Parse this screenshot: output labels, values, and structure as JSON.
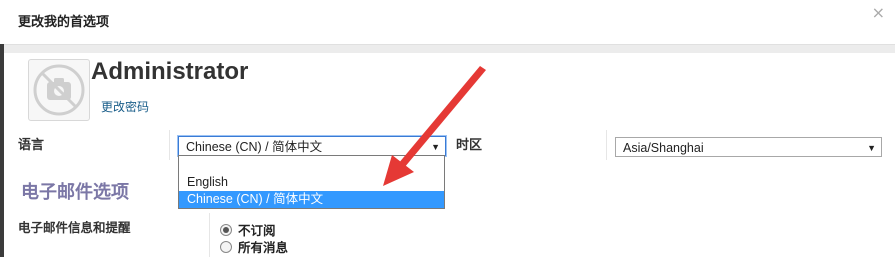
{
  "dialog": {
    "title": "更改我的首选项",
    "close_label": "×"
  },
  "profile": {
    "avatar_icon": "camera-off-icon",
    "name": "Administrator",
    "change_password_link": "更改密码"
  },
  "language": {
    "label": "语言",
    "selected": "Chinese (CN) / 简体中文",
    "options": [
      "English",
      "Chinese (CN) / 简体中文"
    ],
    "dropdown_open": true
  },
  "timezone": {
    "label": "时区",
    "selected": "Asia/Shanghai"
  },
  "email_options": {
    "section_title": "电子邮件选项",
    "notifications_label": "电子邮件信息和提醒",
    "radio_options": [
      {
        "label": "不订阅",
        "checked": true
      },
      {
        "label": "所有消息",
        "checked": false
      }
    ]
  },
  "colors": {
    "accent": "#3399ff",
    "section_title": "#7b77a6",
    "link": "#1a5e8a",
    "annotation_arrow": "#e53935"
  },
  "icons": {
    "dropdown_arrow": "chevron-down-icon",
    "annotation": "red-arrow-icon"
  }
}
